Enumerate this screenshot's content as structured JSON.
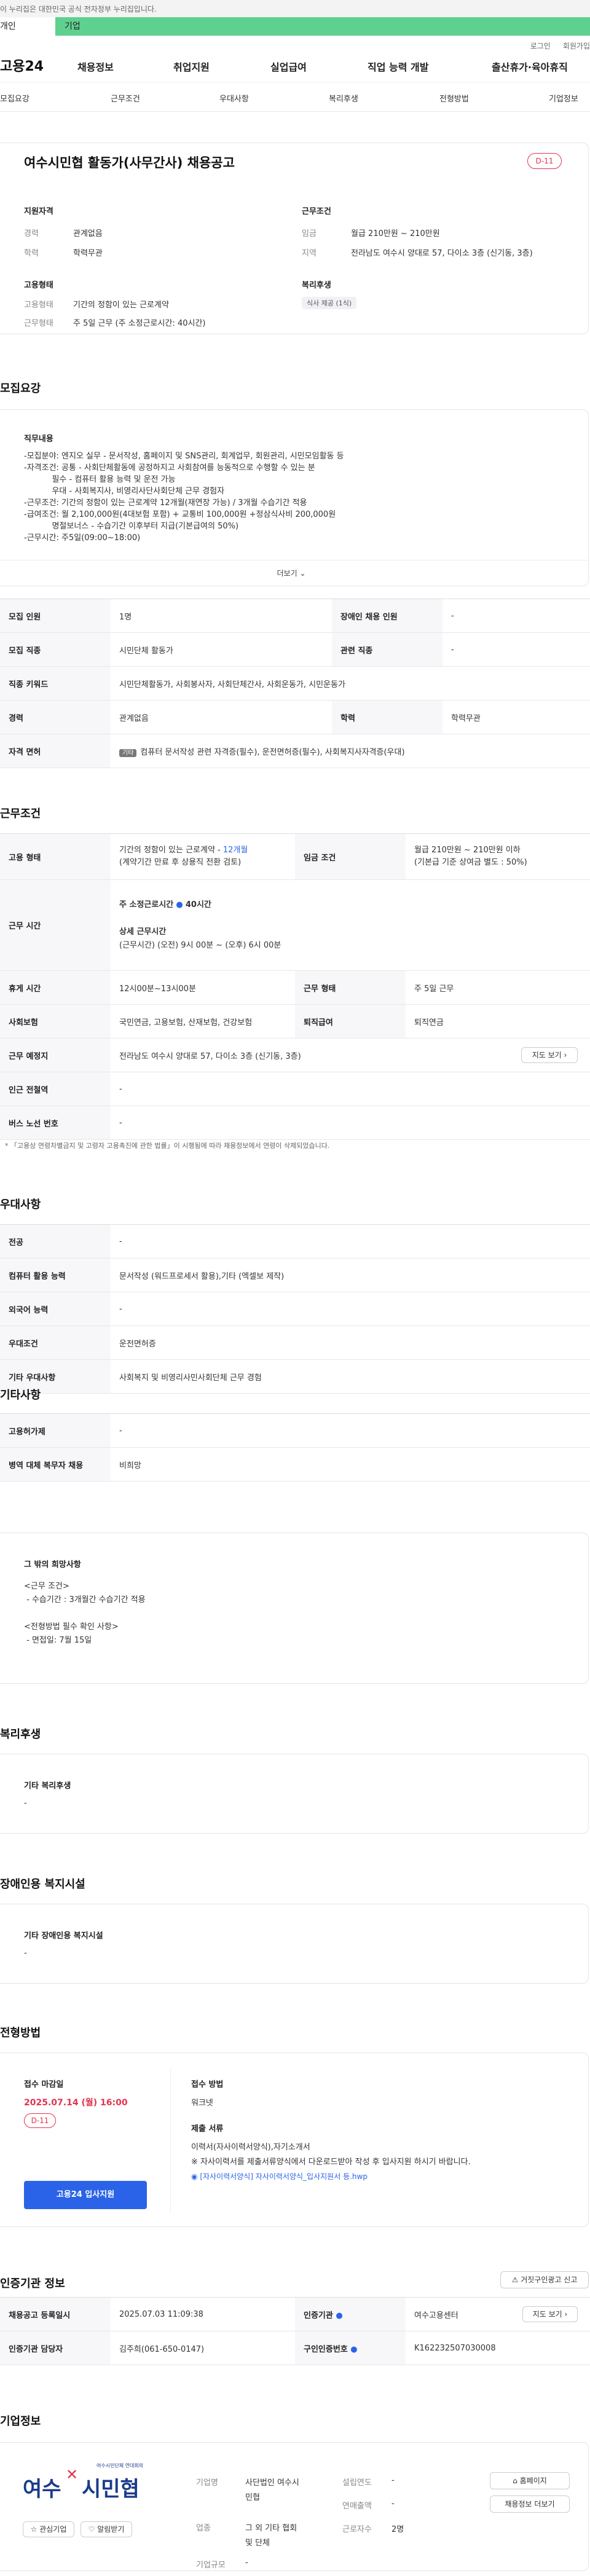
{
  "gov_notice": "이 누리집은 대한민국 공식 전자정부 누리집입니다.",
  "tabs": [
    "개인",
    "기업"
  ],
  "util": [
    "로그인",
    "회원가입"
  ],
  "logo": "고용24",
  "gnb": [
    "채용정보",
    "취업지원",
    "실업급여",
    "직업 능력 개발",
    "출산휴가·육아휴직"
  ],
  "subnav": [
    "모집요강",
    "근무조건",
    "우대사항",
    "복리후생",
    "전형방법",
    "기업정보"
  ],
  "title": "여수시민협 활동가(사무간사) 채용공고",
  "dday": "D-11",
  "summary": {
    "qual_h": "지원자격",
    "work_h": "근무조건",
    "career_k": "경력",
    "career_v": "관계없음",
    "edu_k": "학력",
    "edu_v": "학력무관",
    "pay_k": "임금",
    "pay_v": "월급 210만원 ~ 210만원",
    "place_k": "지역",
    "place_v": "전라남도 여수시 양대로 57, 다이소 3층 (신기동, 3층)",
    "emp_h": "고용형태",
    "emp_k": "고용형태",
    "emp_v": "기간의 정함이 있는 근로계약",
    "hours_k": "근무형태",
    "hours_v": "주 5일 근무 (주 소정근로시간: 40시간)",
    "welfare_h": "복리후생",
    "welfare_tag": "식사 제공 (1식)"
  },
  "recruit": {
    "sec": "모집요강",
    "duty_h": "직무내용",
    "duty_text": "-모집분야: 엔지오 실무 - 문서작성, 홈페이지 및 SNS관리, 회계업무, 회원관리, 시민모임활동 등\n-자격조건: 공통 - 사회단체활동에 공정하지고 사회참여를 능동적으로 수행할 수 있는 분\n           필수 - 컴퓨터 활용 능력 및 운전 가능\n           우대 - 사회복지사, 비영리사단사회단체 근무 경험자\n-근무조건: 기간의 정함이 있는 근로계약 12개월(재연장 가능) / 3개월 수습기간 적용\n-급여조건: 월 2,100,000원(4대보험 포함) + 교통비 100,000원 +정삼식사비 200,000원\n           명절보너스 - 수습기간 이후부터 지급(기본급여의 50%)\n-근무시간: 주5일(09:00~18:00)",
    "more": "더보기",
    "rows": [
      {
        "k": "모집 인원",
        "v": "1명",
        "k2": "장애인 채용 인원",
        "v2": "-"
      },
      {
        "k": "모집 직종",
        "v": "시민단체 활동가",
        "k2": "관련 직종",
        "v2": "-"
      },
      {
        "k": "직종 키워드",
        "v": "시민단체활동가, 사회봉사자, 사회단체간사, 사회운동가, 시민운동가"
      },
      {
        "k": "경력",
        "v": "관계없음",
        "k2": "학력",
        "v2": "학력무관"
      },
      {
        "k": "자격 면허",
        "tag": "기타",
        "v": "컴퓨터 문서작성 관련 자격증(필수), 운전면허증(필수), 사회복지사자격증(우대)"
      }
    ]
  },
  "cond": {
    "sec": "근무조건",
    "emp_k": "고용 형태",
    "emp_v1": "기간의 정함이 있는 근로계약 - ",
    "emp_v1b": "12개월",
    "emp_v2": "(계약기간 만료 후 상용직 전환 검토)",
    "pay_k": "임금 조건",
    "pay_v1": "월급 210만원 ~ 210만원 이하",
    "pay_v2": "(기본급 기준 상여금 별도 : 50%)",
    "time_k": "근무 시간",
    "time_v1": "주 소정근로시간",
    "time_v1b": "40시간",
    "time_detail_h": "상세 근무시간",
    "time_detail": "(근무시간) (오전) 9시 00분 ~ (오후) 6시 00분",
    "break_k": "휴게 시간",
    "break_v": "12시00분~13시00분",
    "type_k": "근무 형태",
    "type_v": "주 5일 근무",
    "ins_k": "사회보험",
    "ins_v": "국민연금, 고용보험, 산재보험, 건강보험",
    "ret_k": "퇴직급여",
    "ret_v": "퇴직연금",
    "loc_k": "근무 예정지",
    "loc_v": "전라남도 여수시 양대로 57, 다이소 3층 (신기동, 3층)",
    "map_btn": "지도 보기",
    "sub_k": "인근 전철역",
    "sub_v": "-",
    "bus_k": "버스 노선 번호",
    "bus_v": "-",
    "note": "* 「고용상 연령차별금지 및 고령자 고용촉진에 관한 법률」이 시행됨에 따라 채용정보에서 연령이 삭제되었습니다."
  },
  "pref": {
    "sec": "우대사항",
    "rows": [
      [
        "전공",
        "-"
      ],
      [
        "컴퓨터 활용 능력",
        "문서작성 (워드프로세서 활용),기타 (엑셀보 제작)"
      ],
      [
        "외국어 능력",
        "-"
      ],
      [
        "우대조건",
        "운전면허증"
      ],
      [
        "기타 우대사항",
        "사회복지 및 비영리사민사회단체 근무 경험"
      ]
    ]
  },
  "etc": {
    "sec": "기타사항",
    "rows": [
      [
        "고용허가제",
        "-"
      ],
      [
        "병역 대체 복무자 채용",
        "비희망"
      ]
    ],
    "box_h": "그 밖의 희망사항",
    "box_text": "<근무 조건>\n - 수습기간 : 3개월간 수습기간 적용\n\n<전형방법 필수 확인 사항>\n - 면접일: 7월 15일"
  },
  "welfare": {
    "sec": "복리후생",
    "box_h": "기타 복리후생",
    "box_v": "-"
  },
  "disab": {
    "sec": "장애인용 복지시설",
    "box_h": "기타 장애인용 복지시설",
    "box_v": "-"
  },
  "proc": {
    "sec": "전형방법",
    "deadline_h": "접수 마감일",
    "deadline": "2025.07.14 (월) 16:00",
    "dday": "D-11",
    "apply_btn": "고용24 입사지원",
    "method_h": "접수 방법",
    "method_v": "워크넷",
    "docs_h": "제출 서류",
    "docs_v1": "이력서(자사이력서양식),자기소개서",
    "docs_v2": "※ 자사이력서를 제출서류양식에서 다운로드받아 작성 후 입사지원 하시기 바랍니다.",
    "file": "[자사이력서양식] 자사이력서양식_입사지원서 등.hwp"
  },
  "agency": {
    "sec": "인증기관 정보",
    "report_btn": "거짓구인광고 신고",
    "reg_k": "채용공고 등록일시",
    "reg_v": "2025.07.03 11:09:38",
    "ag_k": "인증기관",
    "ag_v": "여수고용센터",
    "map_btn": "지도 보기",
    "mgr_k": "인증기관 담당자",
    "mgr_v": "김주희(061-650-0147)",
    "no_k": "구인인증번호",
    "no_v": "K162232507030008"
  },
  "company": {
    "sec": "기업정보",
    "logo_a": "여수",
    "logo_b": "시민협",
    "logo_small": "여수시민단체 연대회의",
    "interest_btn": "관심기업",
    "alarm_btn": "알림받기",
    "name_k": "기업명",
    "name_v1": "사단법인 여수시",
    "name_v2": "민협",
    "ind_k": "업종",
    "ind_v1": "그 외 기타 협회",
    "ind_v2": "및 단체",
    "scale_k": "기업규모",
    "scale_v": "-",
    "est_k": "설립연도",
    "est_v": "-",
    "sales_k": "연매출액",
    "sales_v": "-",
    "emp_k": "근로자수",
    "emp_v": "2명",
    "home_btn": "홈페이지",
    "more_btn": "채용정보 더보기"
  },
  "colors": {
    "accent": "#2b63e8",
    "tab_green": "#5ed08f",
    "red": "#e3334f"
  }
}
